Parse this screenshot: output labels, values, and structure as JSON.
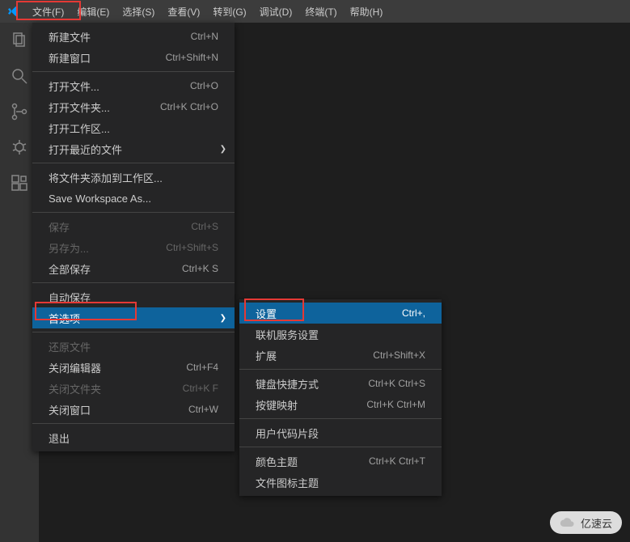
{
  "menubar": {
    "items": [
      {
        "label": "文件(F)"
      },
      {
        "label": "编辑(E)"
      },
      {
        "label": "选择(S)"
      },
      {
        "label": "查看(V)"
      },
      {
        "label": "转到(G)"
      },
      {
        "label": "调试(D)"
      },
      {
        "label": "终端(T)"
      },
      {
        "label": "帮助(H)"
      }
    ]
  },
  "file_menu": {
    "groups": [
      [
        {
          "label": "新建文件",
          "shortcut": "Ctrl+N"
        },
        {
          "label": "新建窗口",
          "shortcut": "Ctrl+Shift+N"
        }
      ],
      [
        {
          "label": "打开文件...",
          "shortcut": "Ctrl+O"
        },
        {
          "label": "打开文件夹...",
          "shortcut": "Ctrl+K Ctrl+O"
        },
        {
          "label": "打开工作区..."
        },
        {
          "label": "打开最近的文件",
          "submenu": true
        }
      ],
      [
        {
          "label": "将文件夹添加到工作区..."
        },
        {
          "label": "Save Workspace As..."
        }
      ],
      [
        {
          "label": "保存",
          "shortcut": "Ctrl+S",
          "disabled": true
        },
        {
          "label": "另存为...",
          "shortcut": "Ctrl+Shift+S",
          "disabled": true
        },
        {
          "label": "全部保存",
          "shortcut": "Ctrl+K S"
        }
      ],
      [
        {
          "label": "自动保存"
        },
        {
          "label": "首选项",
          "submenu": true,
          "selected": true
        }
      ],
      [
        {
          "label": "还原文件",
          "disabled": true
        },
        {
          "label": "关闭编辑器",
          "shortcut": "Ctrl+F4"
        },
        {
          "label": "关闭文件夹",
          "shortcut": "Ctrl+K F",
          "disabled": true
        },
        {
          "label": "关闭窗口",
          "shortcut": "Ctrl+W"
        }
      ],
      [
        {
          "label": "退出"
        }
      ]
    ]
  },
  "prefs_menu": {
    "groups": [
      [
        {
          "label": "设置",
          "shortcut": "Ctrl+,",
          "selected": true
        },
        {
          "label": "联机服务设置"
        },
        {
          "label": "扩展",
          "shortcut": "Ctrl+Shift+X"
        }
      ],
      [
        {
          "label": "键盘快捷方式",
          "shortcut": "Ctrl+K Ctrl+S"
        },
        {
          "label": "按键映射",
          "shortcut": "Ctrl+K Ctrl+M"
        }
      ],
      [
        {
          "label": "用户代码片段"
        }
      ],
      [
        {
          "label": "颜色主题",
          "shortcut": "Ctrl+K Ctrl+T"
        },
        {
          "label": "文件图标主题"
        }
      ]
    ]
  },
  "footer": {
    "label": "亿速云"
  },
  "submenu_arrow": "❯"
}
